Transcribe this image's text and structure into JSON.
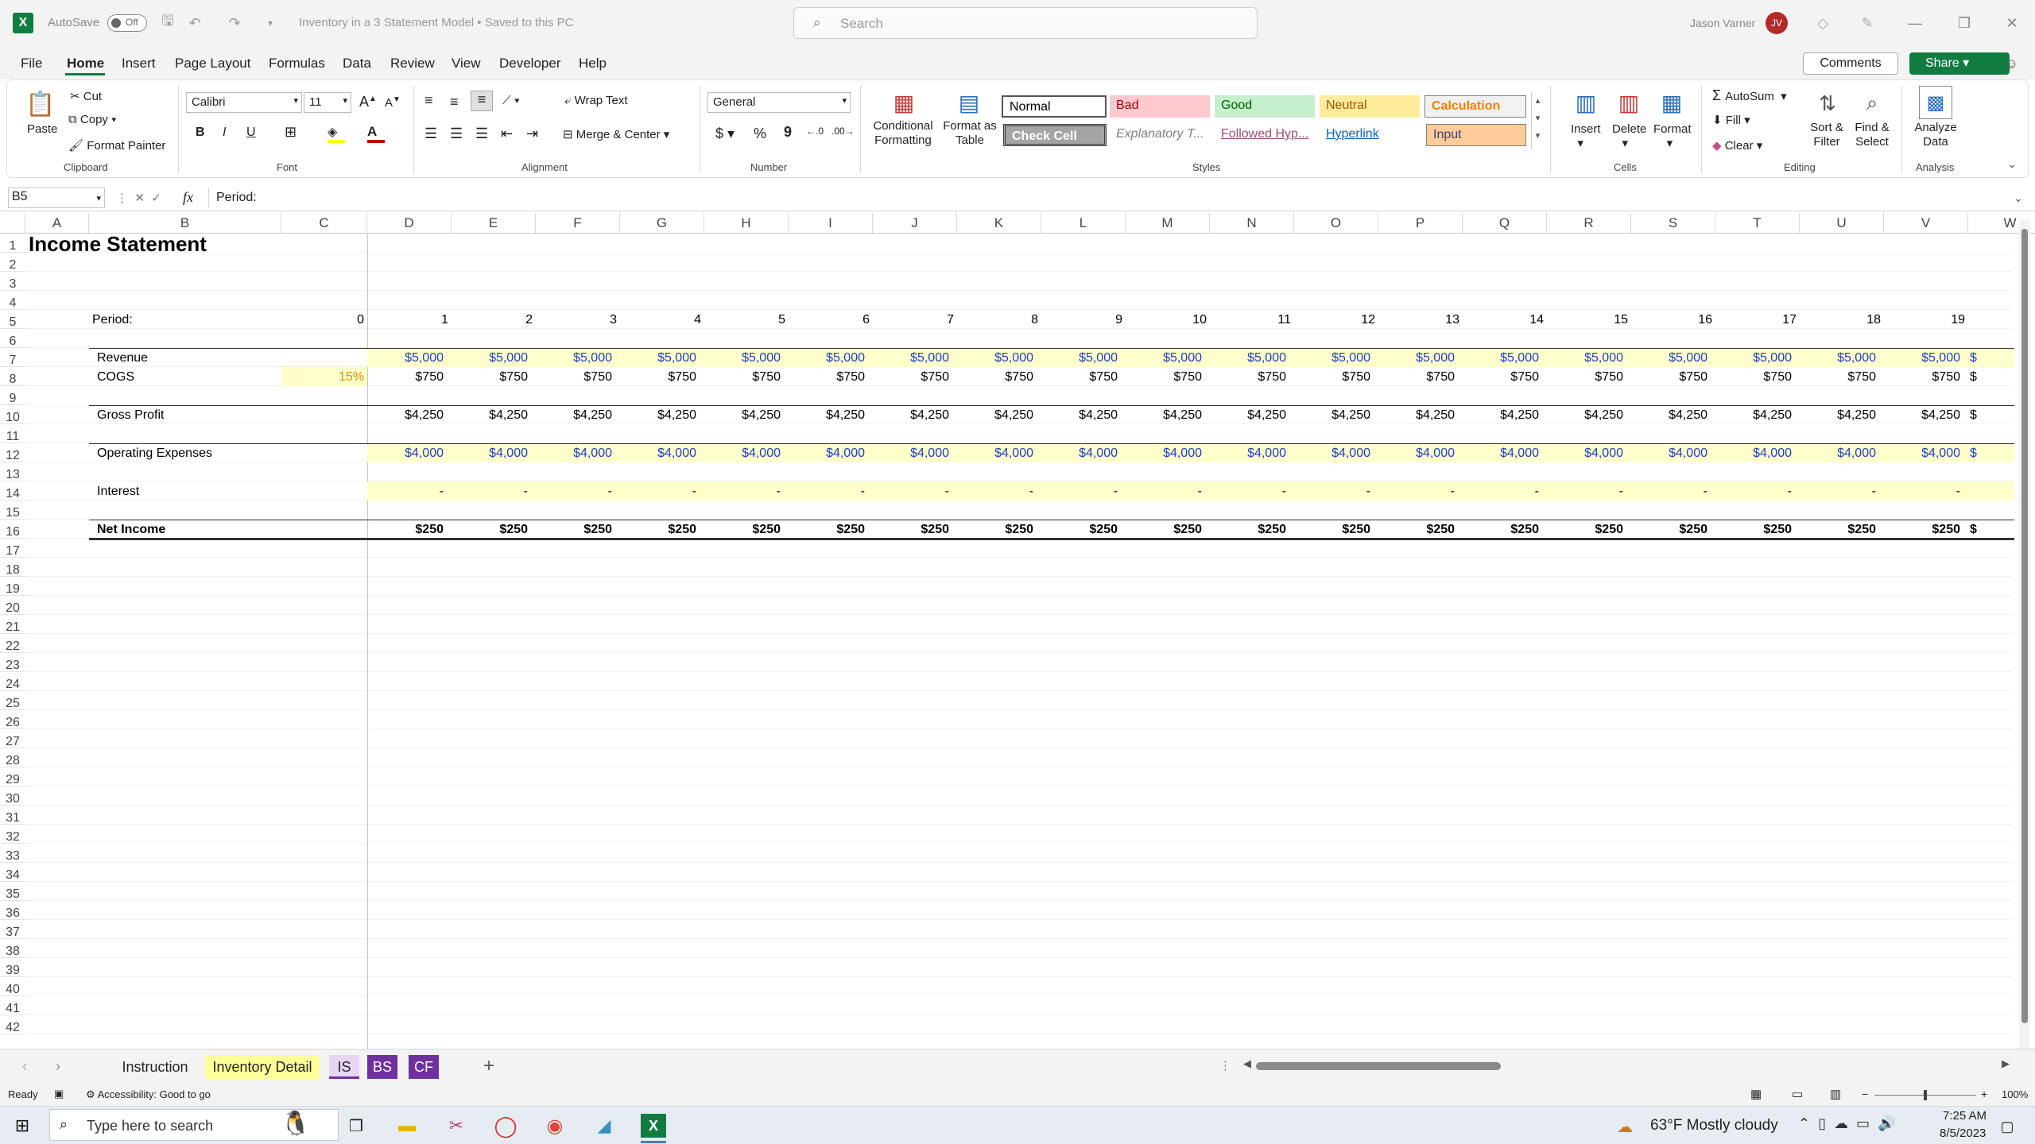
{
  "titlebar": {
    "autosave_label": "AutoSave",
    "autosave_state": "Off",
    "title": "Inventory in a 3 Statement Model • Saved to this PC",
    "search_placeholder": "Search",
    "user_name": "Jason Varner",
    "user_initials": "JV"
  },
  "menu": [
    "File",
    "Home",
    "Insert",
    "Page Layout",
    "Formulas",
    "Data",
    "Review",
    "View",
    "Developer",
    "Help"
  ],
  "menu_active": "Home",
  "menu_right": {
    "comments": "Comments",
    "share": "Share"
  },
  "ribbon": {
    "clipboard": {
      "paste": "Paste",
      "cut": "Cut",
      "copy": "Copy",
      "format_painter": "Format Painter",
      "group": "Clipboard"
    },
    "font": {
      "name": "Calibri",
      "size": "11",
      "group": "Font",
      "bold": "B",
      "italic": "I",
      "underline": "U"
    },
    "alignment": {
      "wrap_text": "Wrap Text",
      "merge_center": "Merge & Center",
      "group": "Alignment"
    },
    "number": {
      "format": "General",
      "currency": "$",
      "percent": "%",
      "comma": "9",
      "group": "Number"
    },
    "styles": {
      "conditional_formatting": "Conditional Formatting",
      "format_as_table": "Format as Table",
      "normal": "Normal",
      "bad": "Bad",
      "good": "Good",
      "neutral": "Neutral",
      "calculation": "Calculation",
      "check_cell": "Check Cell",
      "explanatory": "Explanatory T...",
      "followed_hyperlink": "Followed Hyp...",
      "hyperlink": "Hyperlink",
      "input": "Input",
      "group": "Styles"
    },
    "cells": {
      "insert": "Insert",
      "delete": "Delete",
      "format": "Format",
      "group": "Cells"
    },
    "editing": {
      "autosum": "AutoSum",
      "fill": "Fill",
      "clear": "Clear",
      "sort_filter": "Sort & Filter",
      "find_select": "Find & Select",
      "group": "Editing"
    },
    "analysis": {
      "analyze_data": "Analyze Data",
      "group": "Analysis"
    }
  },
  "formula_bar": {
    "name_box": "B5",
    "fx": "fx",
    "content": "Period:"
  },
  "columns": [
    "A",
    "B",
    "C",
    "D",
    "E",
    "F",
    "G",
    "H",
    "I",
    "J",
    "K",
    "L",
    "M",
    "N",
    "O",
    "P",
    "Q",
    "R",
    "S",
    "T",
    "U",
    "V",
    "W"
  ],
  "sheet": {
    "title": "Income Statement",
    "period_label": "Period:",
    "periods": [
      "0",
      "1",
      "2",
      "3",
      "4",
      "5",
      "6",
      "7",
      "8",
      "9",
      "10",
      "11",
      "12",
      "13",
      "14",
      "15",
      "16",
      "17",
      "18",
      "19"
    ],
    "cogs_pct": "15%",
    "rows": {
      "revenue": {
        "label": "Revenue",
        "value": "$5,000"
      },
      "cogs": {
        "label": "COGS",
        "value": "$750"
      },
      "gross_profit": {
        "label": "Gross Profit",
        "value": "$4,250"
      },
      "opex": {
        "label": "Operating Expenses",
        "value": "$4,000"
      },
      "interest": {
        "label": "Interest",
        "value": "-"
      },
      "net_income": {
        "label": "Net Income",
        "value": "$250"
      }
    },
    "cut_value": "$"
  },
  "sheet_tabs": [
    "Instruction",
    "Inventory Detail",
    "IS",
    "BS",
    "CF"
  ],
  "sheet_tab_active": "IS",
  "status": {
    "ready": "Ready",
    "accessibility": "Accessibility: Good to go",
    "zoom": "100%"
  },
  "taskbar": {
    "search_placeholder": "Type here to search",
    "weather": "63°F  Mostly cloudy",
    "time": "7:25 AM",
    "date": "8/5/2023"
  },
  "colors": {
    "excel_green": "#107c41",
    "input_yellow": "#ffffcc",
    "tab_purple": "#7030a0",
    "blue_text": "#1f3fbf"
  }
}
